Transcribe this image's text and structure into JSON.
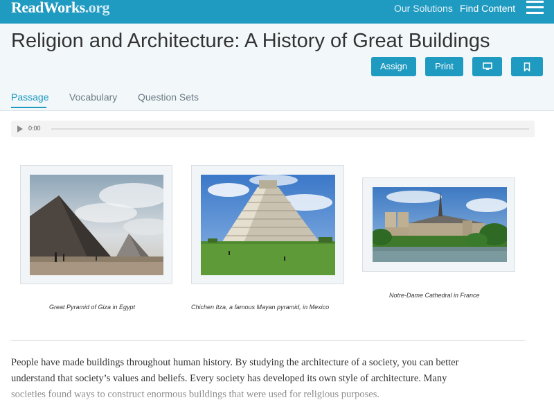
{
  "nav": {
    "logo_main": "ReadWorks",
    "logo_suffix": ".org",
    "links": [
      "Our Solutions",
      "Find Content"
    ],
    "menu_icon": "hamburger-icon"
  },
  "header": {
    "title": "Religion and Architecture: A History of Great Buildings",
    "buttons": {
      "assign": "Assign",
      "print": "Print",
      "present_icon": "monitor-icon",
      "bookmark_icon": "bookmark-icon"
    },
    "tabs": [
      "Passage",
      "Vocabulary",
      "Question Sets"
    ],
    "active_tab": "Passage"
  },
  "audio": {
    "time": "0:00",
    "play_icon": "play-icon"
  },
  "figures": [
    {
      "caption": "Great Pyramid of Giza in Egypt"
    },
    {
      "caption": "Chichen Itza, a famous Mayan pyramid, in Mexico"
    },
    {
      "caption": "Notre-Dame Cathedral in France"
    }
  ],
  "passage": {
    "line1": "People have made buildings throughout human history. By studying the architecture of a society, you can better",
    "line2": "understand that society’s values and beliefs. Every society has developed its own style of architecture. Many",
    "line3": "societies found ways to construct enormous buildings that were used for religious purposes."
  },
  "colors": {
    "brand": "#1f9ac1",
    "header_bg": "#f2f7fa"
  }
}
